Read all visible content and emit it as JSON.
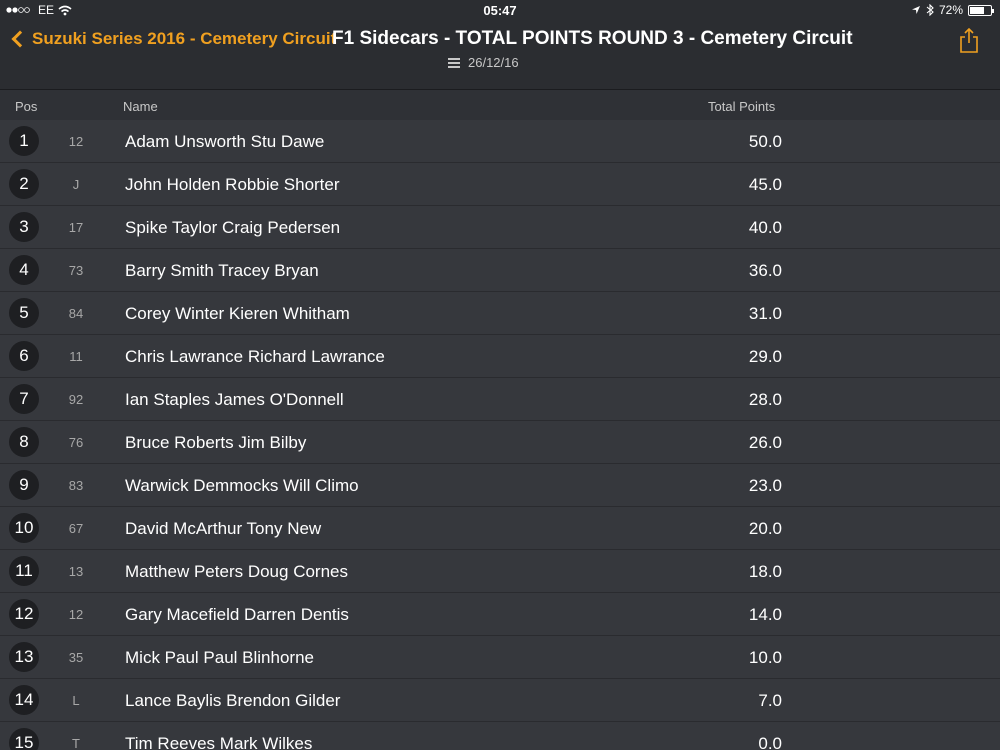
{
  "status": {
    "carrier": "EE",
    "time": "05:47",
    "battery": "72%",
    "battery_level": 0.72
  },
  "nav": {
    "back_label": "Suzuki Series 2016 - Cemetery Circuit",
    "title": "F1 Sidecars - TOTAL POINTS ROUND 3 - Cemetery Circuit",
    "date": "26/12/16"
  },
  "table": {
    "headers": {
      "pos": "Pos",
      "name": "Name",
      "points": "Total Points"
    },
    "rows": [
      {
        "pos": "1",
        "num": "12",
        "name": "Adam Unsworth Stu Dawe",
        "points": "50.0"
      },
      {
        "pos": "2",
        "num": "J",
        "name": "John Holden Robbie Shorter",
        "points": "45.0"
      },
      {
        "pos": "3",
        "num": "17",
        "name": "Spike Taylor Craig Pedersen",
        "points": "40.0"
      },
      {
        "pos": "4",
        "num": "73",
        "name": "Barry Smith Tracey Bryan",
        "points": "36.0"
      },
      {
        "pos": "5",
        "num": "84",
        "name": "Corey Winter Kieren Whitham",
        "points": "31.0"
      },
      {
        "pos": "6",
        "num": "11",
        "name": "Chris Lawrance Richard Lawrance",
        "points": "29.0"
      },
      {
        "pos": "7",
        "num": "92",
        "name": "Ian Staples James O'Donnell",
        "points": "28.0"
      },
      {
        "pos": "8",
        "num": "76",
        "name": "Bruce Roberts Jim Bilby",
        "points": "26.0"
      },
      {
        "pos": "9",
        "num": "83",
        "name": "Warwick Demmocks Will Climo",
        "points": "23.0"
      },
      {
        "pos": "10",
        "num": "67",
        "name": "David McArthur Tony New",
        "points": "20.0"
      },
      {
        "pos": "11",
        "num": "13",
        "name": "Matthew Peters Doug Cornes",
        "points": "18.0"
      },
      {
        "pos": "12",
        "num": "12",
        "name": "Gary Macefield Darren Dentis",
        "points": "14.0"
      },
      {
        "pos": "13",
        "num": "35",
        "name": "Mick Paul Paul Blinhorne",
        "points": "10.0"
      },
      {
        "pos": "14",
        "num": "L",
        "name": "Lance Baylis Brendon Gilder",
        "points": "7.0"
      },
      {
        "pos": "15",
        "num": "T",
        "name": "Tim Reeves Mark Wilkes",
        "points": "0.0"
      }
    ]
  },
  "colors": {
    "accent": "#f0a020",
    "background": "#2f3136",
    "row": "#36383d"
  }
}
